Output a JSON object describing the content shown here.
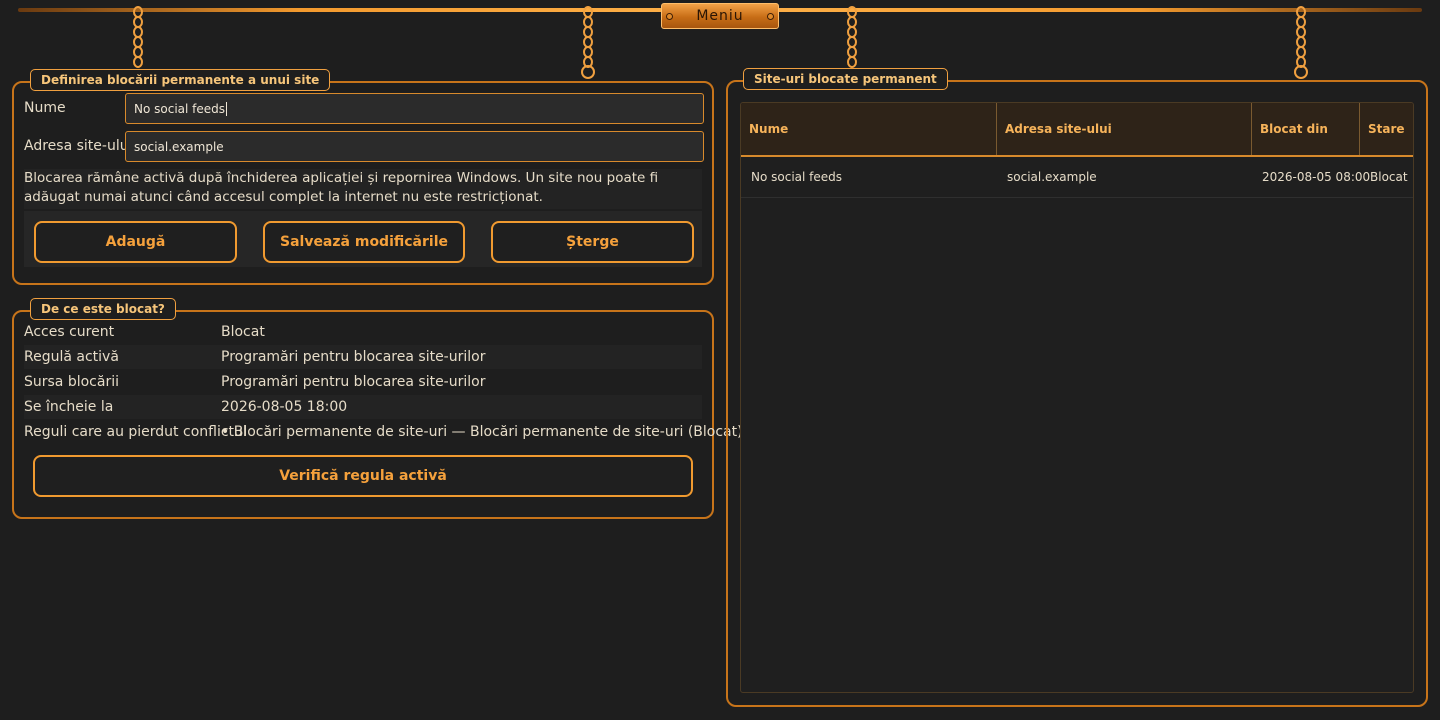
{
  "menu": {
    "label": "Meniu"
  },
  "define_panel": {
    "title": "Definirea blocării permanente a unui site",
    "name_label": "Nume",
    "name_value": "No social feeds",
    "address_label": "Adresa site-ului",
    "address_value": "social.example",
    "info": "Blocarea rămâne activă după închiderea aplicației și repornirea Windows. Un site nou poate fi adăugat numai atunci când accesul complet la internet nu este restricționat.",
    "buttons": {
      "add": "Adaugă",
      "save": "Salvează modificările",
      "delete": "Șterge"
    }
  },
  "why_panel": {
    "title": "De ce este blocat?",
    "rows": [
      {
        "key": "Acces curent",
        "value": "Blocat"
      },
      {
        "key": "Regulă activă",
        "value": "Programări pentru blocarea site-urilor"
      },
      {
        "key": "Sursa blocării",
        "value": "Programări pentru blocarea site-urilor"
      },
      {
        "key": "Se încheie la",
        "value": "2026-08-05 18:00"
      },
      {
        "key": "Reguli care au pierdut conflictul",
        "value": "• Blocări permanente de site-uri — Blocări permanente de site-uri (Blocat)"
      }
    ],
    "check_button": "Verifică regula activă"
  },
  "blocked_panel": {
    "title": "Site-uri blocate permanent",
    "columns": [
      "Nume",
      "Adresa site-ului",
      "Blocat din",
      "Stare"
    ],
    "rows": [
      [
        "No social feeds",
        "social.example",
        "2026-08-05 08:00",
        "Blocat"
      ]
    ]
  },
  "colors": {
    "accent": "#f09a30",
    "background": "#1e1e1e",
    "text": "#e6dcc8"
  }
}
